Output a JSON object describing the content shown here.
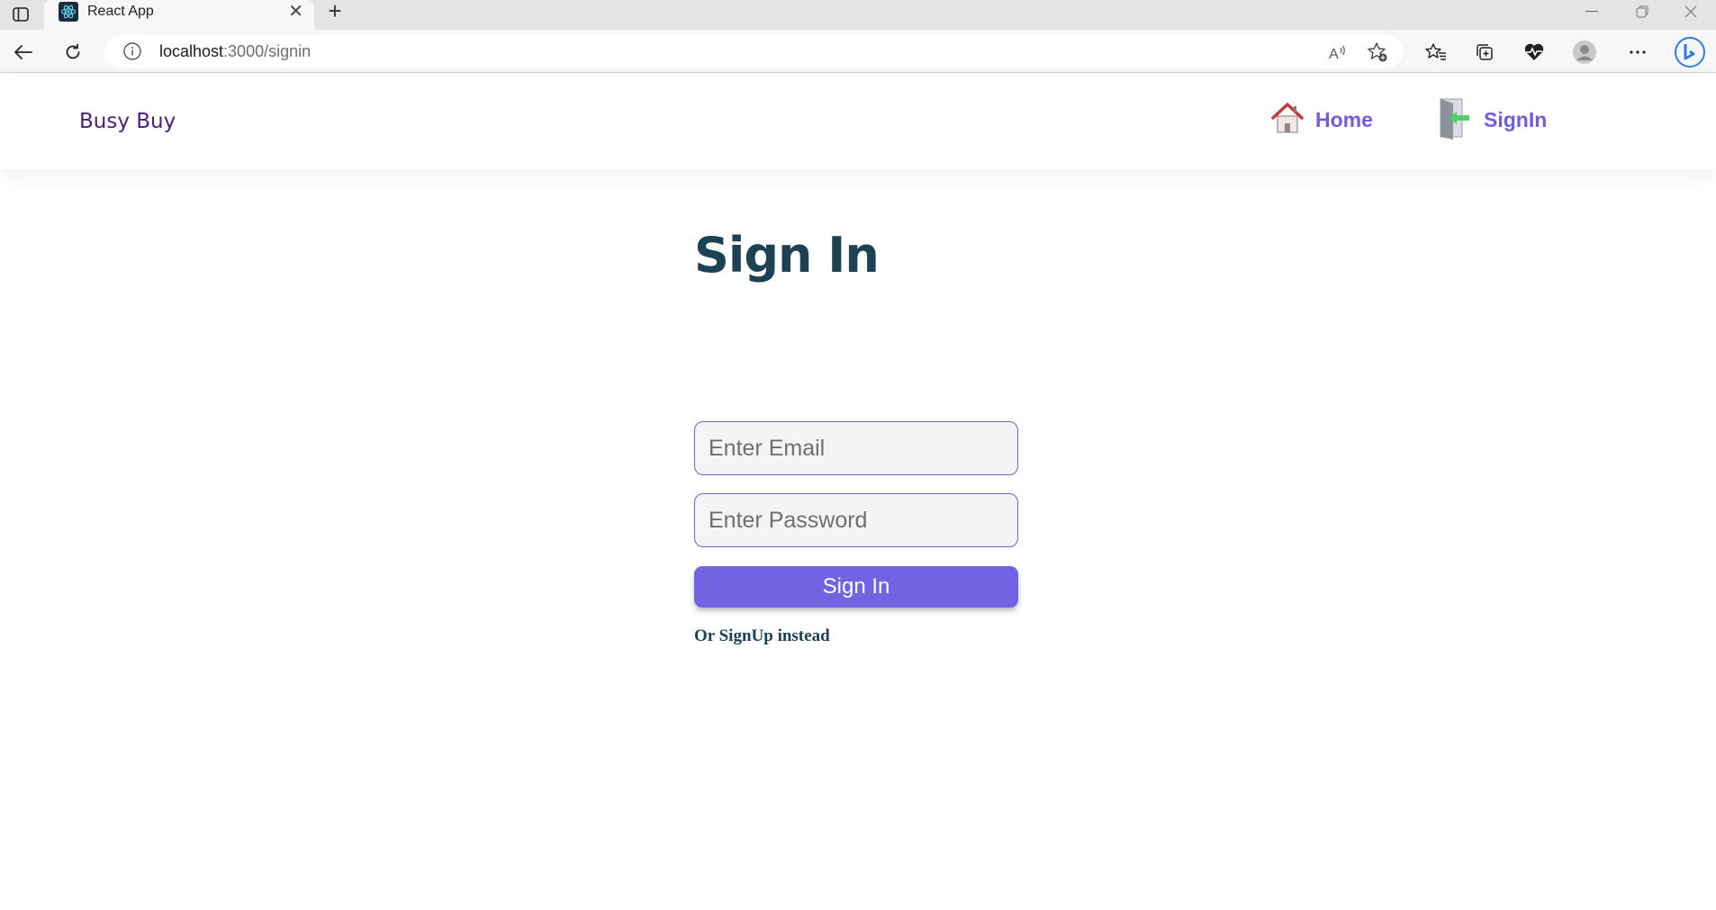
{
  "browser": {
    "tab": {
      "title": "React App",
      "favicon": "react-logo-icon"
    },
    "address": {
      "host": "localhost",
      "path": ":3000/signin"
    },
    "icons": [
      "sidebar-toggle-icon",
      "close-icon",
      "new-tab-icon",
      "back-icon",
      "reload-icon",
      "info-icon",
      "read-aloud-icon",
      "add-favorite-icon",
      "favorites-icon",
      "collections-icon",
      "health-icon",
      "profile-icon",
      "more-icon",
      "bing-icon",
      "minimize-icon",
      "restore-icon",
      "window-close-icon"
    ]
  },
  "navbar": {
    "brand": "Busy Buy",
    "links": [
      {
        "label": "Home",
        "icon": "house-icon"
      },
      {
        "label": "SignIn",
        "icon": "door-signin-icon"
      }
    ]
  },
  "form": {
    "title": "Sign In",
    "email_placeholder": "Enter Email",
    "password_placeholder": "Enter Password",
    "submit_label": "Sign In",
    "alt_link": "Or SignUp instead"
  },
  "colors": {
    "accent": "#7163e1",
    "nav_link": "#6d5fd9",
    "brand": "#4a1f7a",
    "heading": "#1c4254"
  }
}
